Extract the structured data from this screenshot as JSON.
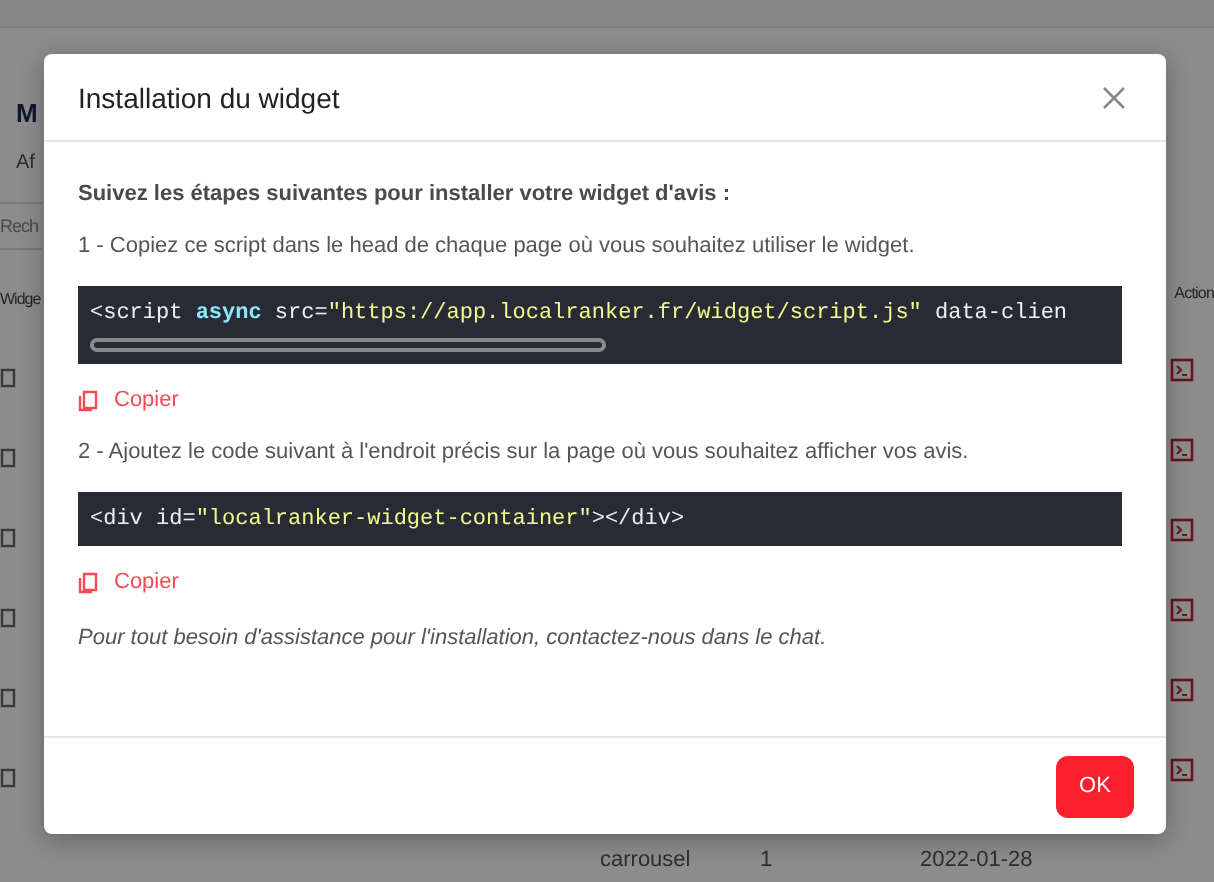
{
  "background": {
    "title": "M",
    "subtitle": "Af",
    "search": {
      "placeholder": "Rech"
    },
    "columns": [
      "Widge",
      "Action"
    ],
    "rows": [
      {
        "kind": "row"
      },
      {
        "kind": "row"
      },
      {
        "kind": "row"
      },
      {
        "kind": "row"
      },
      {
        "kind": "row"
      },
      {
        "kind": "row",
        "cells": [
          "carrousel",
          "1",
          "2022-01-28"
        ]
      }
    ]
  },
  "modal": {
    "title": "Installation du widget",
    "intro": "Suivez les étapes suivantes pour installer votre widget d'avis :",
    "steps": [
      {
        "text": "1 - Copiez ce script dans le head de chaque page où vous souhaitez utiliser le widget.",
        "scrollable": true,
        "copy": "Copier",
        "code": [
          {
            "kind": "plain",
            "text": "<script "
          },
          {
            "kind": "keyword",
            "text": "async"
          },
          {
            "kind": "plain",
            "text": " src="
          },
          {
            "kind": "string",
            "text": "\"https://app.localranker.fr/widget/script.js\""
          },
          {
            "kind": "plain",
            "text": " data-clien"
          }
        ]
      },
      {
        "text": "2 - Ajoutez le code suivant à l'endroit précis sur la page où vous souhaitez afficher vos avis.",
        "scrollable": false,
        "copy": "Copier",
        "code": [
          {
            "kind": "plain",
            "text": "<div id="
          },
          {
            "kind": "string",
            "text": "\"localranker-widget-container\""
          },
          {
            "kind": "plain",
            "text": "></div>"
          }
        ]
      }
    ],
    "note": "Pour tout besoin d'assistance pour l'installation, contactez-nous dans le chat.",
    "ok": "OK"
  }
}
